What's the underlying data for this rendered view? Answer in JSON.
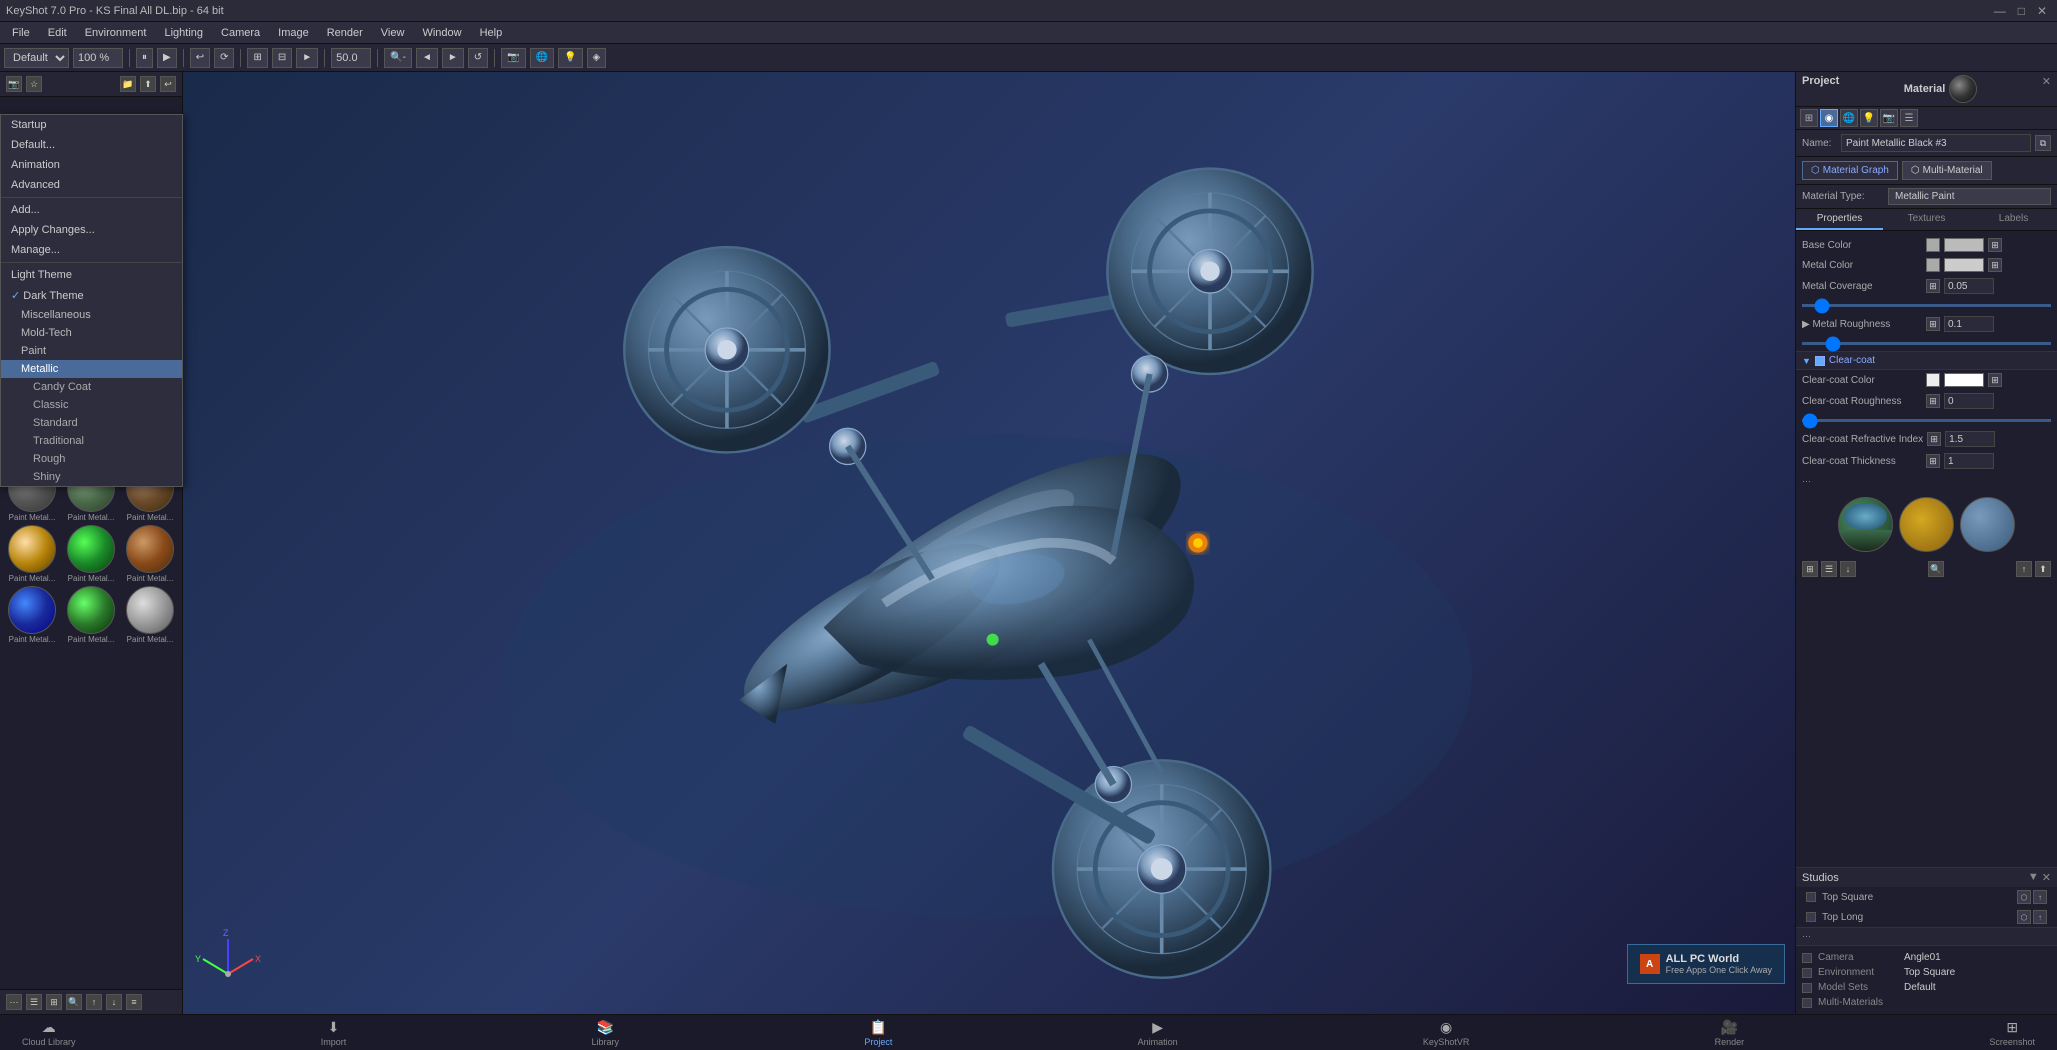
{
  "titlebar": {
    "title": "KeyShot 7.0 Pro - KS Final All DL.bip - 64 bit",
    "controls": [
      "—",
      "□",
      "✕"
    ]
  },
  "menubar": {
    "items": [
      "File",
      "Edit",
      "Environment",
      "Lighting",
      "Camera",
      "Image",
      "Render",
      "View",
      "Window",
      "Help"
    ]
  },
  "toolbar": {
    "preset": "Default",
    "zoom": "100 %"
  },
  "sidebar": {
    "header_icons": [
      "📷",
      "☆",
      "📁",
      "⬆",
      "↩"
    ],
    "menu_items": [
      {
        "id": "startup",
        "label": "Startup",
        "indent": 0
      },
      {
        "id": "default",
        "label": "Default...",
        "indent": 0
      },
      {
        "id": "animation",
        "label": "Animation",
        "indent": 0
      },
      {
        "id": "advanced",
        "label": "Advanced",
        "indent": 0
      },
      {
        "id": "add",
        "label": "Add...",
        "indent": 0
      },
      {
        "id": "apply_changes",
        "label": "Apply Changes...",
        "indent": 0
      },
      {
        "id": "manage",
        "label": "Manage...",
        "indent": 0
      },
      {
        "id": "separator1",
        "type": "separator"
      },
      {
        "id": "light_theme",
        "label": "Light Theme",
        "indent": 0
      },
      {
        "id": "dark_theme",
        "label": "Dark Theme",
        "indent": 0,
        "checked": true
      },
      {
        "id": "miscellaneous",
        "label": "Miscellaneous",
        "indent": 1
      },
      {
        "id": "mold_tech",
        "label": "Mold-Tech",
        "indent": 1
      },
      {
        "id": "paint",
        "label": "Paint",
        "indent": 1
      },
      {
        "id": "metallic",
        "label": "Metallic",
        "indent": 2,
        "active": true
      },
      {
        "id": "candy_coat",
        "label": "Candy Coat",
        "indent": 3
      },
      {
        "id": "classic",
        "label": "Classic",
        "indent": 3
      },
      {
        "id": "standard",
        "label": "Standard",
        "indent": 3
      },
      {
        "id": "traditional",
        "label": "Traditional",
        "indent": 3
      },
      {
        "id": "rough",
        "label": "Rough",
        "indent": 3
      },
      {
        "id": "shiny",
        "label": "Shiny",
        "indent": 3
      }
    ],
    "bottom_icons": [
      "⋯",
      "☰",
      "⊞",
      "⊟",
      "↑",
      "↓",
      "≡"
    ]
  },
  "swatches": [
    {
      "id": "s1",
      "class": "gold",
      "label": "Paint Metal..."
    },
    {
      "id": "s2",
      "class": "black-metal",
      "label": "Paint Metal..."
    },
    {
      "id": "s3",
      "class": "blue-metal",
      "label": "Paint Metal..."
    },
    {
      "id": "s4",
      "class": "dark-blue",
      "label": "Paint Metal..."
    },
    {
      "id": "s5",
      "class": "green-metal",
      "label": "Paint Metal..."
    },
    {
      "id": "s6",
      "class": "red-metal",
      "label": "Paint Metal..."
    },
    {
      "id": "s7",
      "class": "dark-red",
      "label": "Paint Metal..."
    },
    {
      "id": "s8",
      "class": "silver",
      "label": "Paint Metal..."
    },
    {
      "id": "s9",
      "class": "light-silver",
      "label": "Paint Metal..."
    },
    {
      "id": "s10",
      "class": "gray-metal",
      "label": "Paint Metal..."
    },
    {
      "id": "s11",
      "class": "olive-metal",
      "label": "Paint Metal..."
    },
    {
      "id": "s12",
      "class": "brown-metal",
      "label": "Paint Metal..."
    },
    {
      "id": "s13",
      "class": "gold2",
      "label": "Paint Metal..."
    },
    {
      "id": "s14",
      "class": "green2",
      "label": "Paint Metal..."
    },
    {
      "id": "s15",
      "class": "brown2",
      "label": "Paint Metal..."
    },
    {
      "id": "s16",
      "class": "blue2",
      "label": "Paint Metal..."
    },
    {
      "id": "s17",
      "class": "green3",
      "label": "Paint Metal..."
    },
    {
      "id": "s18",
      "class": "silver2",
      "label": "Paint Metal..."
    }
  ],
  "right_panel": {
    "project_label": "Project",
    "material_label": "Material",
    "tab_icons": [
      "grid",
      "sphere",
      "globe",
      "bulb",
      "camera",
      "layers"
    ],
    "name_label": "Name:",
    "name_value": "Paint Metallic Black #3",
    "material_type_label": "Material Type:",
    "material_type_value": "Metallic Paint",
    "material_graph_btn": "Material Graph",
    "multi_material_btn": "Multi-Material",
    "sub_tabs": [
      "Properties",
      "Textures",
      "Labels"
    ],
    "properties": [
      {
        "label": "Base Color",
        "type": "color",
        "color": "#cccccc"
      },
      {
        "label": "Metal Color",
        "type": "color",
        "color": "#cccccc"
      },
      {
        "label": "Metal Coverage",
        "type": "value",
        "value": "0.05",
        "has_slider": true
      },
      {
        "label": "Metal Roughness",
        "type": "value",
        "value": "0.1",
        "has_slider": true,
        "expandable": true
      }
    ],
    "clearcoat_section": {
      "label": "Clear-coat",
      "enabled": true,
      "properties": [
        {
          "label": "Clear-coat Color",
          "type": "color",
          "color": "#ffffff"
        },
        {
          "label": "Clear-coat Roughness",
          "type": "value",
          "value": "0",
          "has_slider": true
        },
        {
          "label": "Clear-coat Refractive Index",
          "type": "value",
          "value": "1.5"
        },
        {
          "label": "Clear-coat Thickness",
          "type": "value",
          "value": "1"
        }
      ]
    },
    "thumbnails": [
      {
        "id": "t1",
        "class": "forest"
      },
      {
        "id": "t2",
        "class": "honeycomb"
      },
      {
        "id": "t3",
        "class": "mountain"
      }
    ],
    "studios_label": "Studios",
    "studios_items": [
      {
        "label": "Top Square",
        "checked": false
      },
      {
        "label": "Top Long",
        "checked": false
      }
    ],
    "camera_info": [
      {
        "label": "Camera",
        "value": "Angle01"
      },
      {
        "label": "Environment",
        "value": "Top Square"
      },
      {
        "label": "Model Sets",
        "value": "Default"
      },
      {
        "label": "Multi-Materials",
        "value": ""
      }
    ]
  },
  "bottom_toolbar": {
    "items": [
      {
        "id": "cloud",
        "label": "Cloud Library",
        "icon": "☁",
        "active": false
      },
      {
        "id": "import",
        "label": "Import",
        "icon": "↓",
        "active": false
      },
      {
        "id": "library",
        "label": "Library",
        "icon": "📚",
        "active": false
      },
      {
        "id": "project",
        "label": "Project",
        "icon": "📋",
        "active": true
      },
      {
        "id": "animation",
        "label": "Animation",
        "icon": "▶",
        "active": false
      },
      {
        "id": "keyshot_vr",
        "label": "KeyShotVR",
        "icon": "◉",
        "active": false
      },
      {
        "id": "render",
        "label": "Render",
        "icon": "📷",
        "active": false
      },
      {
        "id": "screenshot",
        "label": "Screenshot",
        "icon": "⊞",
        "active": false
      }
    ]
  }
}
